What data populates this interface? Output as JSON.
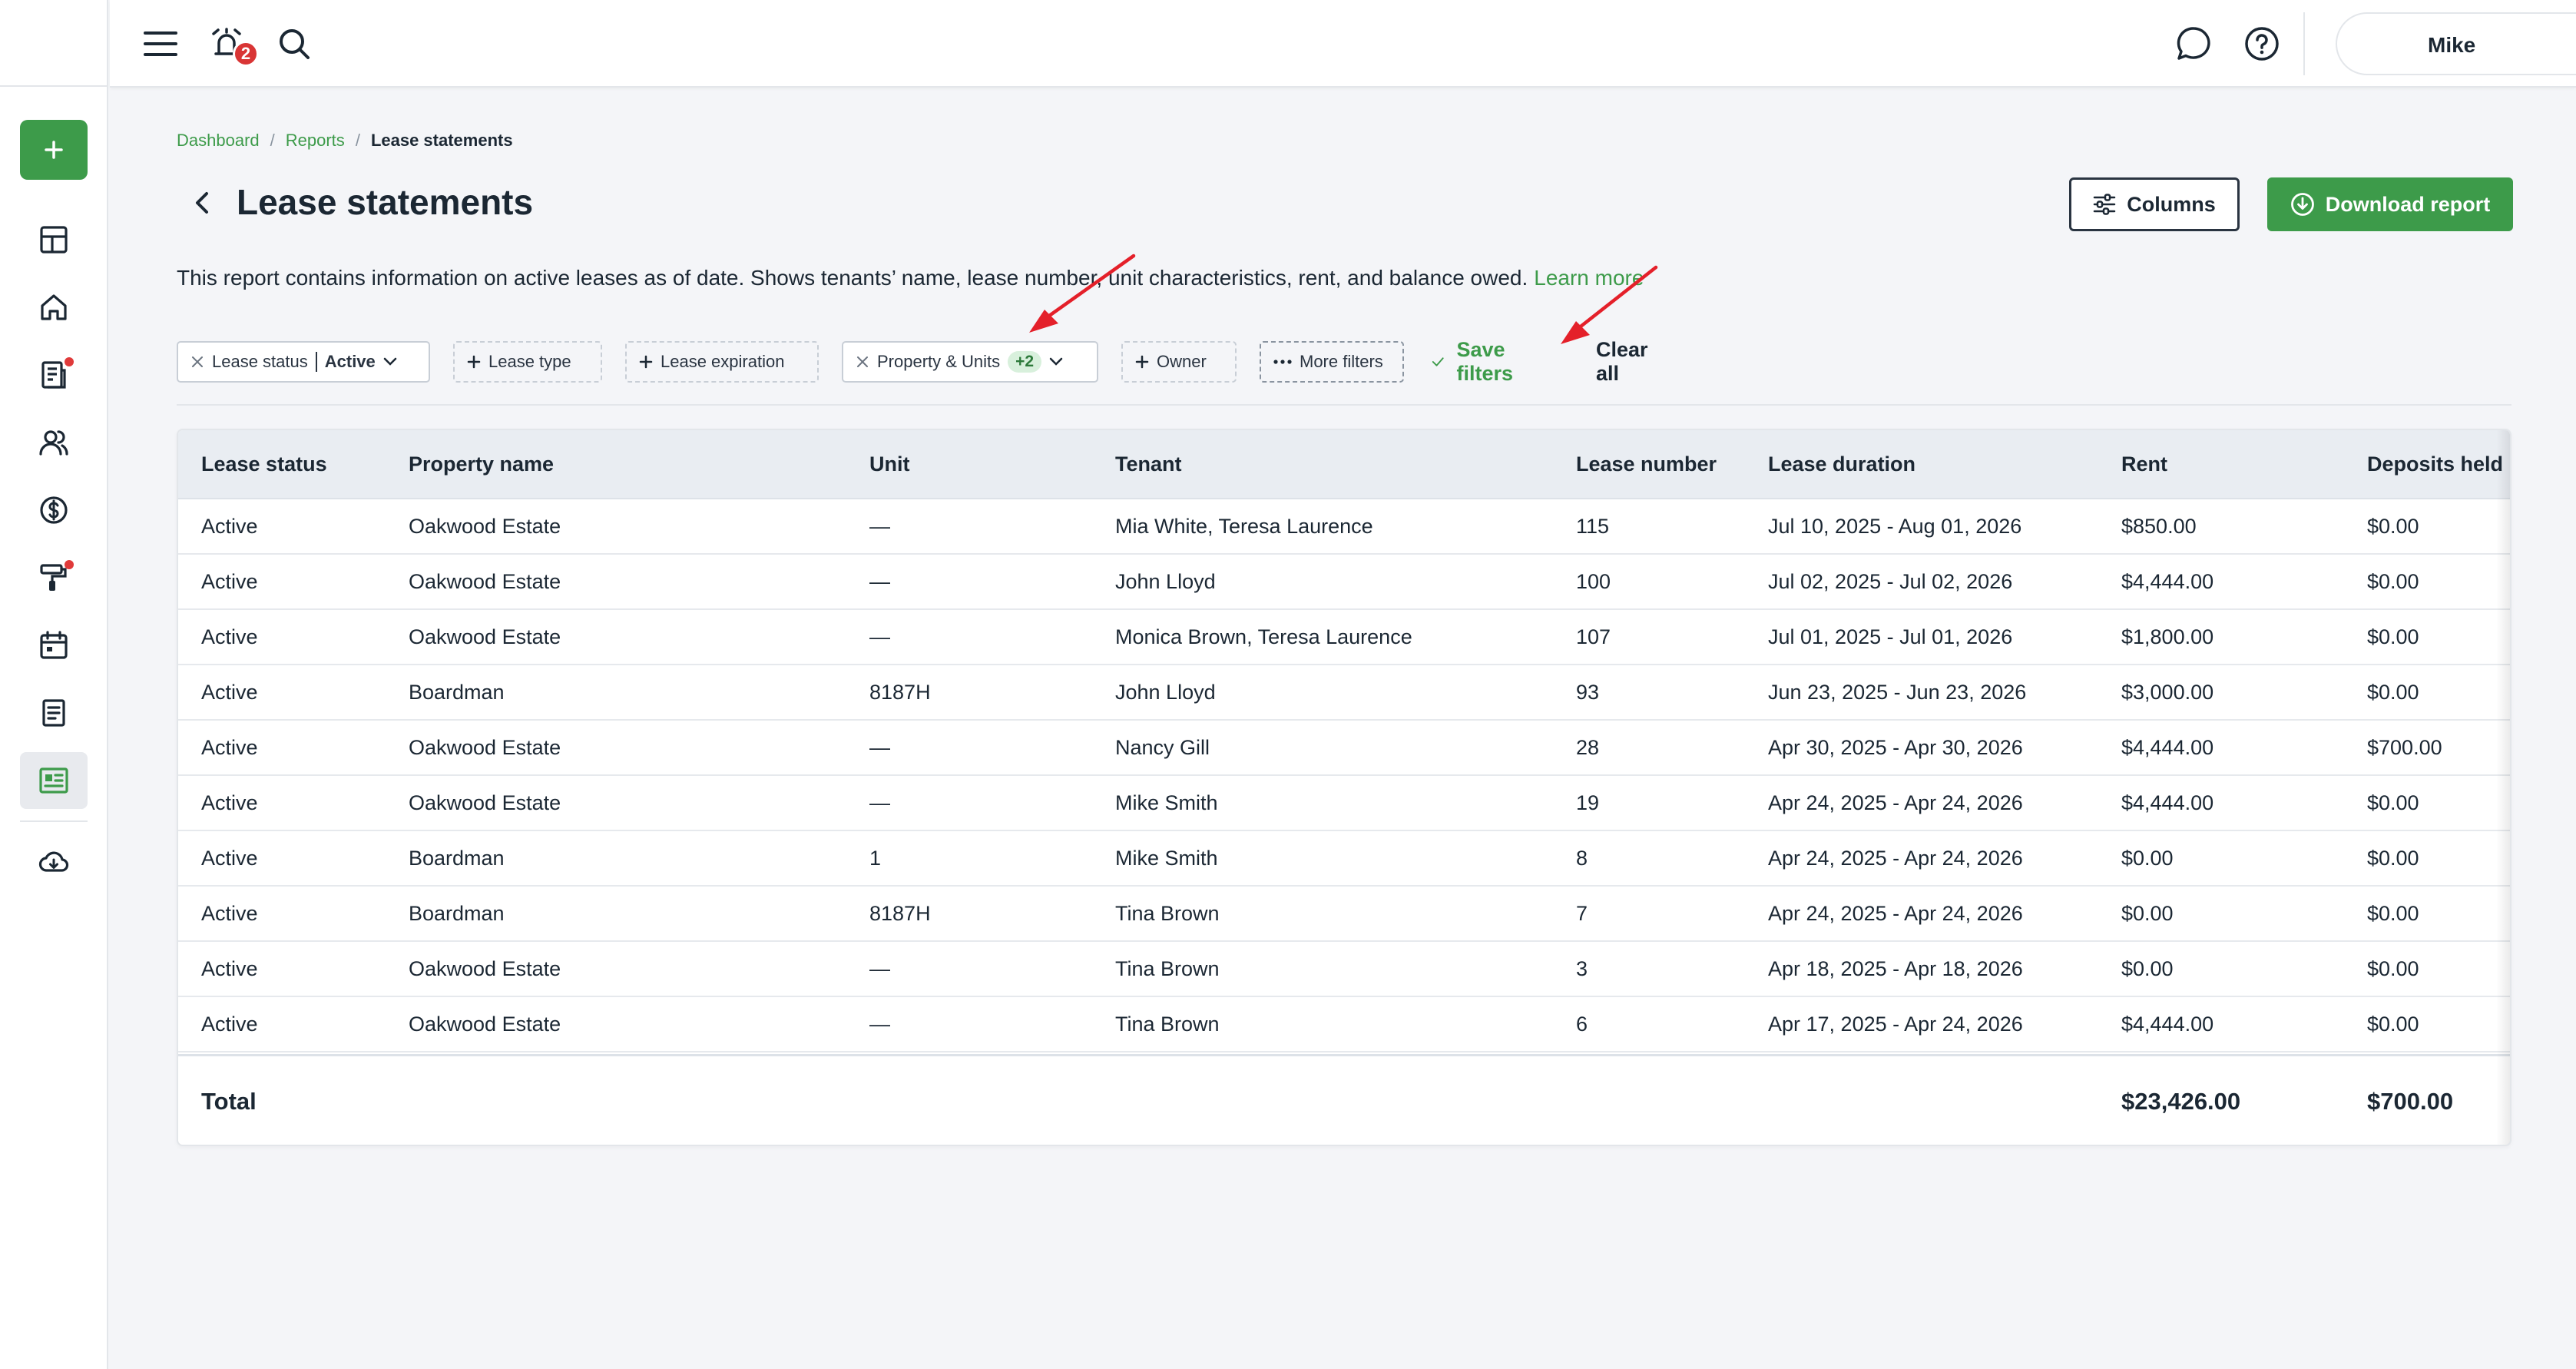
{
  "sidebar": {
    "add_label": "+",
    "items": [
      {
        "name": "dashboard",
        "icon": "grid-icon",
        "dot": false,
        "active": false
      },
      {
        "name": "properties",
        "icon": "home-icon",
        "dot": false,
        "active": false
      },
      {
        "name": "leasing",
        "icon": "document-icon",
        "dot": true,
        "active": false
      },
      {
        "name": "people",
        "icon": "people-icon",
        "dot": false,
        "active": false
      },
      {
        "name": "accounting",
        "icon": "dollar-icon",
        "dot": false,
        "active": false
      },
      {
        "name": "maintenance",
        "icon": "paint-roller-icon",
        "dot": true,
        "active": false
      },
      {
        "name": "calendar",
        "icon": "calendar-icon",
        "dot": false,
        "active": false
      },
      {
        "name": "notes",
        "icon": "notes-icon",
        "dot": false,
        "active": false
      },
      {
        "name": "reports",
        "icon": "report-icon",
        "dot": false,
        "active": true
      },
      {
        "name": "downloads",
        "icon": "download-cloud-icon",
        "dot": false,
        "active": false
      }
    ]
  },
  "topbar": {
    "notification_count": "2",
    "user_name": "Mike"
  },
  "breadcrumb": {
    "items": [
      "Dashboard",
      "Reports"
    ],
    "separator": "/",
    "current": "Lease statements"
  },
  "page": {
    "title": "Lease statements",
    "columns_button": "Columns",
    "download_button": "Download report",
    "description": "This report contains information on active leases as of date. Shows tenants’ name, lease number, unit characteristics, rent, and balance owed.",
    "learn_more": "Learn more"
  },
  "filters": {
    "lease_status_label": "Lease status",
    "lease_status_value": "Active",
    "lease_type": "Lease type",
    "lease_expiration": "Lease expiration",
    "property_units": "Property & Units",
    "property_units_count": "+2",
    "owner": "Owner",
    "more_filters": "More filters",
    "save_filters": "Save filters",
    "clear_all": "Clear all"
  },
  "table": {
    "columns": [
      "Lease status",
      "Property name",
      "Unit",
      "Tenant",
      "Lease number",
      "Lease duration",
      "Rent",
      "Deposits held"
    ],
    "rows": [
      {
        "status": "Active",
        "property": "Oakwood Estate",
        "unit": "—",
        "tenant": "Mia White, Teresa Laurence",
        "lease": "115",
        "duration": "Jul 10, 2025 - Aug 01, 2026",
        "rent": "$850.00",
        "deposits": "$0.00"
      },
      {
        "status": "Active",
        "property": "Oakwood Estate",
        "unit": "—",
        "tenant": "John Lloyd",
        "lease": "100",
        "duration": "Jul 02, 2025 - Jul 02, 2026",
        "rent": "$4,444.00",
        "deposits": "$0.00"
      },
      {
        "status": "Active",
        "property": "Oakwood Estate",
        "unit": "—",
        "tenant": "Monica Brown, Teresa Laurence",
        "lease": "107",
        "duration": "Jul 01, 2025 - Jul 01, 2026",
        "rent": "$1,800.00",
        "deposits": "$0.00"
      },
      {
        "status": "Active",
        "property": "Boardman",
        "unit": "8187H",
        "tenant": "John Lloyd",
        "lease": "93",
        "duration": "Jun 23, 2025 - Jun 23, 2026",
        "rent": "$3,000.00",
        "deposits": "$0.00"
      },
      {
        "status": "Active",
        "property": "Oakwood Estate",
        "unit": "—",
        "tenant": "Nancy Gill",
        "lease": "28",
        "duration": "Apr 30, 2025 - Apr 30, 2026",
        "rent": "$4,444.00",
        "deposits": "$700.00"
      },
      {
        "status": "Active",
        "property": "Oakwood Estate",
        "unit": "—",
        "tenant": "Mike Smith",
        "lease": "19",
        "duration": "Apr 24, 2025 - Apr 24, 2026",
        "rent": "$4,444.00",
        "deposits": "$0.00"
      },
      {
        "status": "Active",
        "property": "Boardman",
        "unit": "1",
        "tenant": "Mike Smith",
        "lease": "8",
        "duration": "Apr 24, 2025 - Apr 24, 2026",
        "rent": "$0.00",
        "deposits": "$0.00"
      },
      {
        "status": "Active",
        "property": "Boardman",
        "unit": "8187H",
        "tenant": "Tina Brown",
        "lease": "7",
        "duration": "Apr 24, 2025 - Apr 24, 2026",
        "rent": "$0.00",
        "deposits": "$0.00"
      },
      {
        "status": "Active",
        "property": "Oakwood Estate",
        "unit": "—",
        "tenant": "Tina Brown",
        "lease": "3",
        "duration": "Apr 18, 2025 - Apr 18, 2026",
        "rent": "$0.00",
        "deposits": "$0.00"
      },
      {
        "status": "Active",
        "property": "Oakwood Estate",
        "unit": "—",
        "tenant": "Tina Brown",
        "lease": "6",
        "duration": "Apr 17, 2025 - Apr 24, 2026",
        "rent": "$4,444.00",
        "deposits": "$0.00"
      }
    ],
    "total_label": "Total",
    "total_rent": "$23,426.00",
    "total_deposits": "$700.00"
  },
  "colors": {
    "brand_green": "#3d9b4a",
    "alert_red": "#d93535",
    "annotation_red": "#e4202a"
  }
}
